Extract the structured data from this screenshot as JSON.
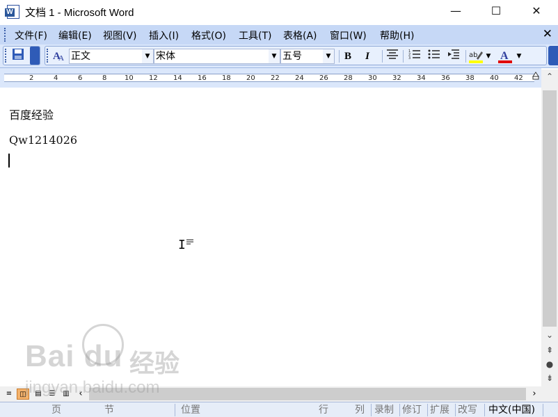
{
  "window": {
    "title": "文档 1 - Microsoft Word",
    "app_icon_letter": "W",
    "controls": {
      "minimize": "—",
      "maximize": "☐",
      "close": "✕"
    }
  },
  "menubar": {
    "items": [
      "文件(F)",
      "编辑(E)",
      "视图(V)",
      "插入(I)",
      "格式(O)",
      "工具(T)",
      "表格(A)",
      "窗口(W)",
      "帮助(H)"
    ],
    "close_doc": "✕"
  },
  "toolbar": {
    "save_icon": "save-icon",
    "style_value": "正文",
    "font_value": "宋体",
    "size_value": "五号",
    "bold": "B",
    "italic": "I",
    "font_color_letter": "A",
    "highlight_label": "ab",
    "font_color": "#e00000",
    "highlight_color": "#ffff00"
  },
  "ruler": {
    "numbers": [
      "2",
      "4",
      "6",
      "8",
      "10",
      "12",
      "14",
      "16",
      "18",
      "20",
      "22",
      "24",
      "26",
      "28",
      "30",
      "32",
      "34",
      "36",
      "38",
      "40",
      "42"
    ]
  },
  "document": {
    "lines": [
      "百度经验",
      "Qw1214026"
    ]
  },
  "statusbar": {
    "page": "页",
    "section": "节",
    "position": "位置",
    "line": "行",
    "column": "列",
    "rec": "录制",
    "trk": "修订",
    "ext": "扩展",
    "ovr": "改写",
    "language": "中文(中国)"
  },
  "watermark": {
    "brand": "Bai  du",
    "brand_cn": "经验",
    "url": "jingyan.baidu.com"
  }
}
